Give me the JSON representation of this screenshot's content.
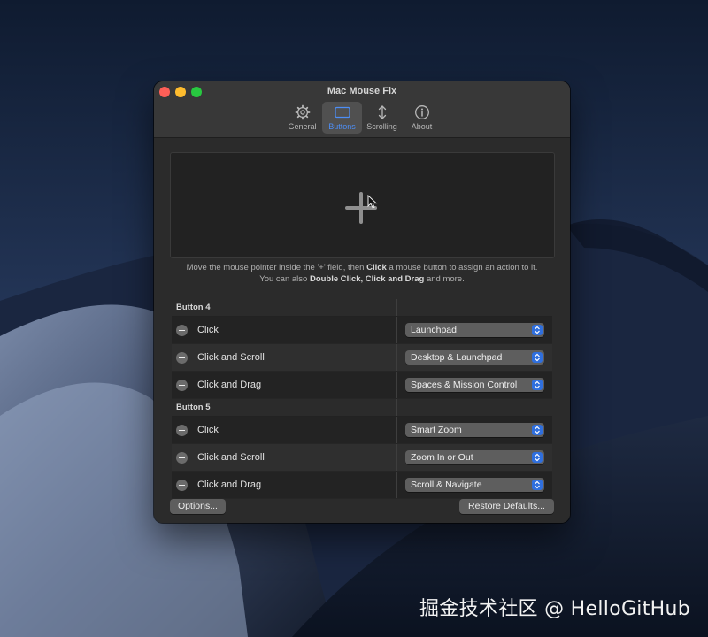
{
  "window": {
    "title": "Mac Mouse Fix"
  },
  "tabs": [
    {
      "label": "General",
      "icon": "gear-icon",
      "active": false
    },
    {
      "label": "Buttons",
      "icon": "mouse-icon",
      "active": true
    },
    {
      "label": "Scrolling",
      "icon": "scroll-arrows-icon",
      "active": false
    },
    {
      "label": "About",
      "icon": "info-icon",
      "active": false
    }
  ],
  "hint": {
    "line1_pre": "Move the mouse pointer inside the '+' field, then ",
    "line1_bold": "Click",
    "line1_post": " a mouse button to assign an action to it.",
    "line2_pre": "You can also ",
    "line2_bold": "Double Click, Click and Drag",
    "line2_post": " and more."
  },
  "groups": [
    {
      "title": "Button 4",
      "rows": [
        {
          "trigger": "Click",
          "action": "Launchpad"
        },
        {
          "trigger": "Click and Scroll",
          "action": "Desktop & Launchpad"
        },
        {
          "trigger": "Click and Drag",
          "action": "Spaces & Mission Control"
        }
      ]
    },
    {
      "title": "Button 5",
      "rows": [
        {
          "trigger": "Click",
          "action": "Smart Zoom"
        },
        {
          "trigger": "Click and Scroll",
          "action": "Zoom In or Out"
        },
        {
          "trigger": "Click and Drag",
          "action": "Scroll & Navigate"
        }
      ]
    }
  ],
  "footer": {
    "options_label": "Options...",
    "restore_label": "Restore Defaults..."
  },
  "watermark": "掘金技术社区 @ HelloGitHub"
}
